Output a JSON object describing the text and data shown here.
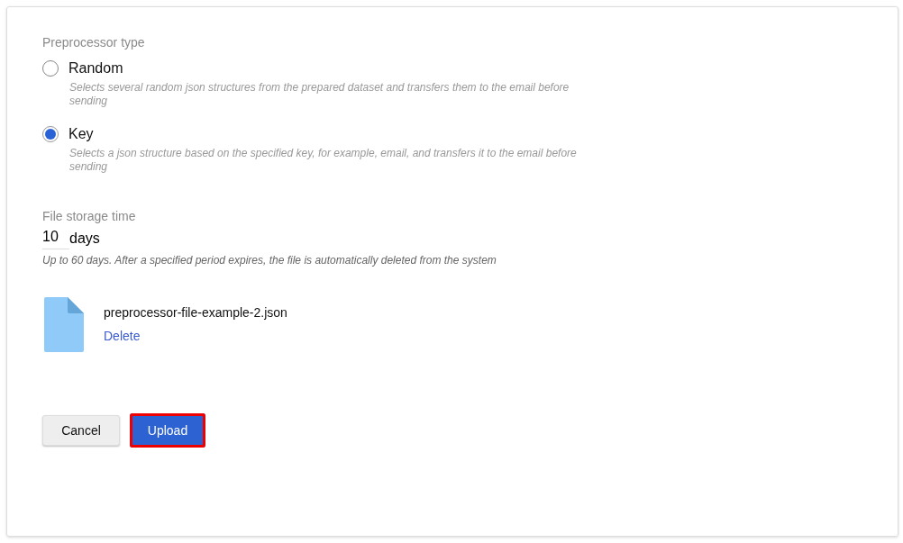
{
  "preprocessor_type": {
    "label": "Preprocessor type",
    "options": [
      {
        "label": "Random",
        "description": "Selects several random json structures from the prepared dataset and transfers them to the email before sending",
        "selected": false
      },
      {
        "label": "Key",
        "description": "Selects a json structure based on the specified key, for example, email, and transfers it to the email before sending",
        "selected": true
      }
    ]
  },
  "storage_time": {
    "label": "File storage time",
    "value": "10",
    "unit": "days",
    "hint": "Up to 60 days. After a specified period expires, the file is automatically deleted from the system"
  },
  "file": {
    "name": "preprocessor-file-example-2.json",
    "action": "Delete"
  },
  "buttons": [
    {
      "label": "Cancel",
      "kind": "secondary",
      "highlighted": false
    },
    {
      "label": "Upload",
      "kind": "primary",
      "highlighted": true
    }
  ]
}
